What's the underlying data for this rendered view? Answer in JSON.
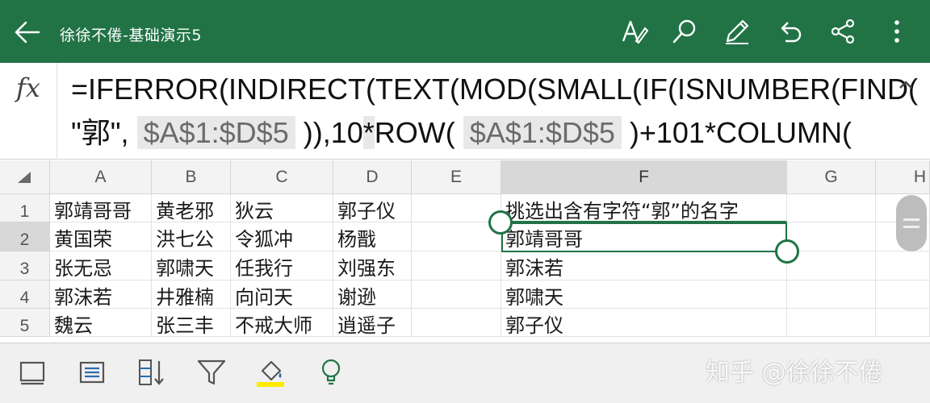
{
  "header": {
    "title": "徐徐不倦-基础演示5",
    "icons": [
      "back-arrow-icon",
      "text-pen-icon",
      "search-icon",
      "draw-pen-icon",
      "undo-icon",
      "share-icon",
      "more-icon"
    ],
    "bar_color": "#217346"
  },
  "formula_bar": {
    "label": "fx",
    "line1": "=IFERROR(INDIRECT(TEXT(MOD(SMALL(IF(ISNUMBER(FIND(",
    "line2_part1": "\"郭\", ",
    "line2_ref1": "$A$1:$D$5",
    "line2_part2": " )),10",
    "line2_star": "*",
    "line2_part3": "ROW( ",
    "line2_ref2": "$A$1:$D$5",
    "line2_part4": " )+101*COLUMN("
  },
  "grid": {
    "columns": [
      "A",
      "B",
      "C",
      "D",
      "E",
      "F",
      "G",
      "H"
    ],
    "rows": [
      "1",
      "2",
      "3",
      "4",
      "5"
    ],
    "cells": [
      [
        "郭靖哥哥",
        "黄老邪",
        "狄云",
        "郭子仪",
        "",
        "挑选出含有字符“郭”的名字"
      ],
      [
        "黄国荣",
        "洪七公",
        "令狐冲",
        "杨戬",
        "",
        "郭靖哥哥"
      ],
      [
        "张无忌",
        "郭啸天",
        "任我行",
        "刘强东",
        "",
        "郭沫若"
      ],
      [
        "郭沫若",
        "井雅楠",
        "向问天",
        "谢逊",
        "",
        "郭啸天"
      ],
      [
        "魏云",
        "张三丰",
        "不戒大师",
        "逍遥子",
        "",
        "郭子仪"
      ]
    ],
    "selected_cell": "F2"
  },
  "toolbar": {
    "icons": [
      "cell-border-icon",
      "wrap-text-icon",
      "sort-icon",
      "filter-icon",
      "fill-color-icon",
      "lightbulb-icon"
    ],
    "fill_color": "#ffeb00"
  },
  "watermark": "知乎 @徐徐不倦"
}
